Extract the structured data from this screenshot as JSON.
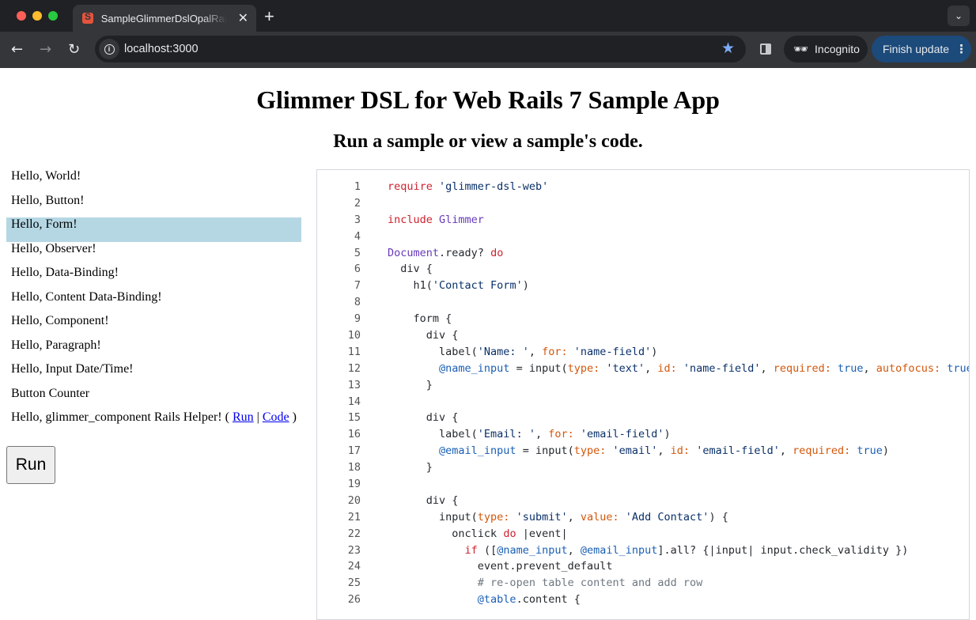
{
  "browser": {
    "tab_title": "SampleGlimmerDslOpalRails7",
    "new_tab_label": "+",
    "url": "localhost:3000",
    "incognito_label": "Incognito",
    "update_label": "Finish update"
  },
  "page": {
    "title": "Glimmer DSL for Web Rails 7 Sample App",
    "subtitle": "Run a sample or view a sample's code."
  },
  "samples": [
    {
      "label": "Hello, World!",
      "selected": false
    },
    {
      "label": "Hello, Button!",
      "selected": false
    },
    {
      "label": "Hello, Form!",
      "selected": true
    },
    {
      "label": "Hello, Observer!",
      "selected": false
    },
    {
      "label": "Hello, Data-Binding!",
      "selected": false
    },
    {
      "label": "Hello, Content Data-Binding!",
      "selected": false
    },
    {
      "label": "Hello, Component!",
      "selected": false
    },
    {
      "label": "Hello, Paragraph!",
      "selected": false
    },
    {
      "label": "Hello, Input Date/Time!",
      "selected": false
    },
    {
      "label": "Button Counter",
      "selected": false
    }
  ],
  "helper_sample": {
    "label": "Hello, glimmer_component Rails Helper! ( ",
    "run_link": "Run",
    "separator": " | ",
    "code_link": "Code",
    "close": " )"
  },
  "run_button": "Run",
  "code": [
    [
      [
        "k",
        "require"
      ],
      [
        "",
        ""
      ],
      [
        "s",
        " 'glimmer-dsl-web'"
      ]
    ],
    [],
    [
      [
        "k",
        "include"
      ],
      [
        "c",
        " Glimmer"
      ]
    ],
    [],
    [
      [
        "c",
        "Document"
      ],
      [
        "",
        ".ready? "
      ],
      [
        "k",
        "do"
      ]
    ],
    [
      [
        "",
        "  div {"
      ]
    ],
    [
      [
        "",
        "    h1("
      ],
      [
        "s",
        "'Contact Form'"
      ],
      [
        "",
        ")"
      ]
    ],
    [],
    [
      [
        "",
        "    form {"
      ]
    ],
    [
      [
        "",
        "      div {"
      ]
    ],
    [
      [
        "",
        "        label("
      ],
      [
        "s",
        "'Name: '"
      ],
      [
        "",
        ", "
      ],
      [
        "sym",
        "for:"
      ],
      [
        "s",
        " 'name-field'"
      ],
      [
        "",
        ")"
      ]
    ],
    [
      [
        "",
        "        "
      ],
      [
        "iv",
        "@name_input"
      ],
      [
        "",
        " = input("
      ],
      [
        "sym",
        "type:"
      ],
      [
        "s",
        " 'text'"
      ],
      [
        "",
        ", "
      ],
      [
        "sym",
        "id:"
      ],
      [
        "s",
        " 'name-field'"
      ],
      [
        "",
        ", "
      ],
      [
        "sym",
        "required:"
      ],
      [
        "b",
        " true"
      ],
      [
        "",
        ", "
      ],
      [
        "sym",
        "autofocus:"
      ],
      [
        "b",
        " true"
      ],
      [
        "",
        ")"
      ]
    ],
    [
      [
        "",
        "      }"
      ]
    ],
    [],
    [
      [
        "",
        "      div {"
      ]
    ],
    [
      [
        "",
        "        label("
      ],
      [
        "s",
        "'Email: '"
      ],
      [
        "",
        ", "
      ],
      [
        "sym",
        "for:"
      ],
      [
        "s",
        " 'email-field'"
      ],
      [
        "",
        ")"
      ]
    ],
    [
      [
        "",
        "        "
      ],
      [
        "iv",
        "@email_input"
      ],
      [
        "",
        " = input("
      ],
      [
        "sym",
        "type:"
      ],
      [
        "s",
        " 'email'"
      ],
      [
        "",
        ", "
      ],
      [
        "sym",
        "id:"
      ],
      [
        "s",
        " 'email-field'"
      ],
      [
        "",
        ", "
      ],
      [
        "sym",
        "required:"
      ],
      [
        "b",
        " true"
      ],
      [
        "",
        ")"
      ]
    ],
    [
      [
        "",
        "      }"
      ]
    ],
    [],
    [
      [
        "",
        "      div {"
      ]
    ],
    [
      [
        "",
        "        input("
      ],
      [
        "sym",
        "type:"
      ],
      [
        "s",
        " 'submit'"
      ],
      [
        "",
        ", "
      ],
      [
        "sym",
        "value:"
      ],
      [
        "s",
        " 'Add Contact'"
      ],
      [
        "",
        ") {"
      ]
    ],
    [
      [
        "",
        "          onclick "
      ],
      [
        "k",
        "do"
      ],
      [
        "",
        " |event|"
      ]
    ],
    [
      [
        "",
        "            "
      ],
      [
        "k",
        "if"
      ],
      [
        "",
        " (["
      ],
      [
        "iv",
        "@name_input"
      ],
      [
        "",
        ", "
      ],
      [
        "iv",
        "@email_input"
      ],
      [
        "",
        "].all? {|input| input.check_validity })"
      ]
    ],
    [
      [
        "",
        "              event.prevent_default"
      ]
    ],
    [
      [
        "",
        "              "
      ],
      [
        "cm",
        "# re-open table content and add row"
      ]
    ],
    [
      [
        "",
        "              "
      ],
      [
        "iv",
        "@table"
      ],
      [
        "",
        ".content {"
      ]
    ]
  ]
}
